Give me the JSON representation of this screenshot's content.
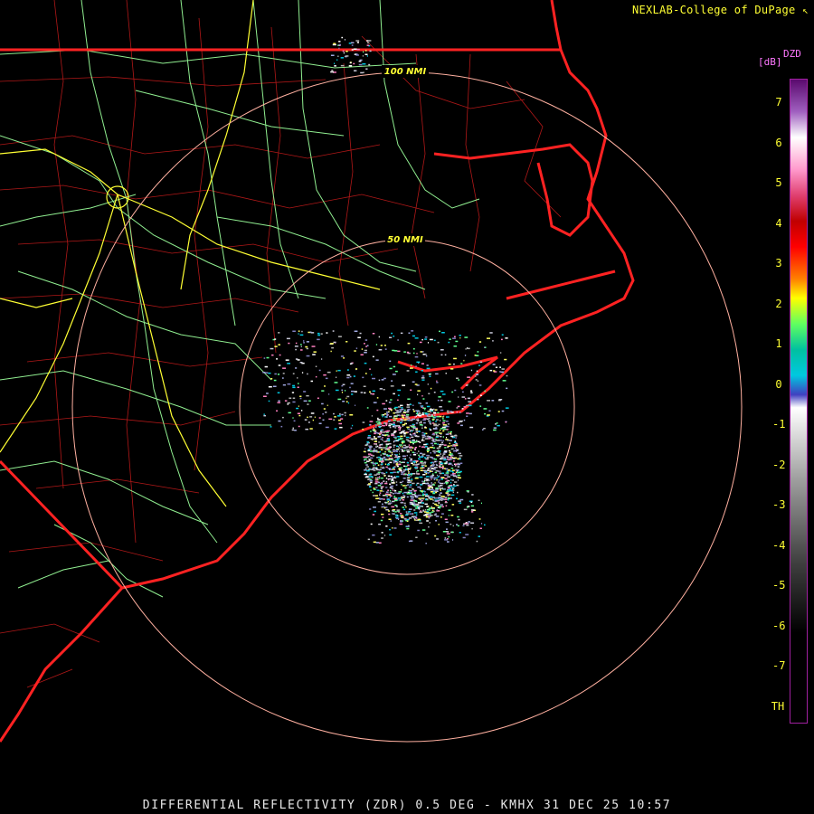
{
  "credit": "NEXLAB-College of DuPage",
  "credit_icon": "cursor-arrow-icon",
  "footer_caption": "DIFFERENTIAL REFLECTIVITY (ZDR) 0.5 DEG - KMHX 31 DEC 25 10:57",
  "range_rings": [
    {
      "label": "100 NMI"
    },
    {
      "label": "50 NMI"
    }
  ],
  "legend": {
    "product": "DZD",
    "unit": "[dB]",
    "labels": [
      "7",
      "6",
      "5",
      "4",
      "3",
      "2",
      "1",
      "0",
      "-1",
      "-2",
      "-3",
      "-4",
      "-5",
      "-6",
      "-7",
      "TH"
    ]
  },
  "colors": {
    "state_borders": "#ff2222",
    "county_lines": "#b01818",
    "highways": "#90ee90",
    "interstates": "#ffff33",
    "range_rings": "#ffb0a0",
    "text": "#ffff33"
  }
}
